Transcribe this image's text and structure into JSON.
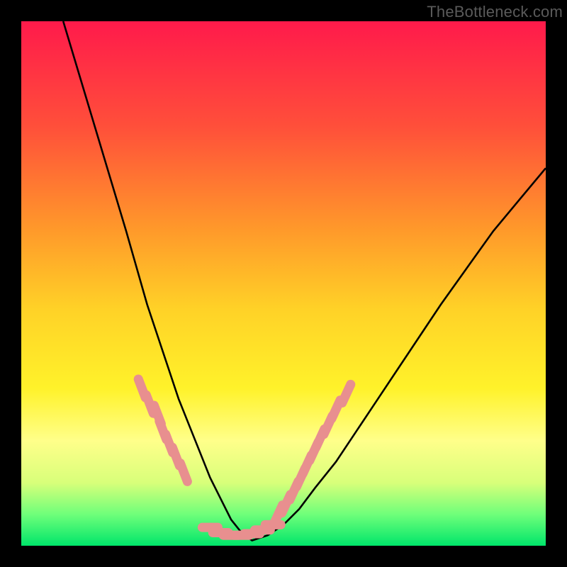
{
  "watermark": {
    "text": "TheBottleneck.com"
  },
  "colors": {
    "black": "#000000",
    "curve": "#000000",
    "marker": "#e88f8f",
    "gradient_stops": [
      {
        "offset": 0.0,
        "color": "#ff1a4b"
      },
      {
        "offset": 0.2,
        "color": "#ff4f3a"
      },
      {
        "offset": 0.4,
        "color": "#ff9a2a"
      },
      {
        "offset": 0.55,
        "color": "#ffd227"
      },
      {
        "offset": 0.7,
        "color": "#fff22a"
      },
      {
        "offset": 0.8,
        "color": "#ffff8a"
      },
      {
        "offset": 0.88,
        "color": "#d8ff7a"
      },
      {
        "offset": 0.94,
        "color": "#6fff7a"
      },
      {
        "offset": 1.0,
        "color": "#00e56a"
      }
    ]
  },
  "chart_data": {
    "type": "line",
    "title": "",
    "xlabel": "",
    "ylabel": "",
    "xlim": [
      0,
      100
    ],
    "ylim": [
      0,
      100
    ],
    "legend": false,
    "grid": false,
    "series": [
      {
        "name": "bottleneck-curve",
        "x": [
          8,
          11,
          14,
          17,
          20,
          22,
          24,
          26,
          28,
          30,
          32,
          34,
          36,
          38,
          40,
          42,
          44,
          47,
          50,
          53,
          56,
          60,
          64,
          68,
          72,
          76,
          80,
          85,
          90,
          95,
          100
        ],
        "values": [
          100,
          90,
          80,
          70,
          60,
          53,
          46,
          40,
          34,
          28,
          23,
          18,
          13,
          9,
          5,
          2.5,
          1,
          2,
          4,
          7,
          11,
          16,
          22,
          28,
          34,
          40,
          46,
          53,
          60,
          66,
          72
        ]
      }
    ],
    "markers": [
      {
        "role": "left-cluster",
        "x": [
          23,
          24.5,
          26,
          27,
          28.2,
          29.5,
          31
        ],
        "y": [
          30,
          27,
          25,
          22,
          19.5,
          17,
          14
        ]
      },
      {
        "role": "bottom-cluster",
        "x": [
          36,
          38,
          40,
          42,
          44,
          46,
          48
        ],
        "y": [
          3.5,
          2.5,
          2,
          2,
          2.3,
          3,
          4
        ]
      },
      {
        "role": "right-cluster",
        "x": [
          49,
          50.5,
          52,
          53.3,
          54.5,
          55.8,
          57,
          58.5,
          60,
          62
        ],
        "y": [
          6,
          8,
          10.5,
          13,
          15.5,
          18,
          20.5,
          23,
          26,
          29
        ]
      }
    ]
  }
}
